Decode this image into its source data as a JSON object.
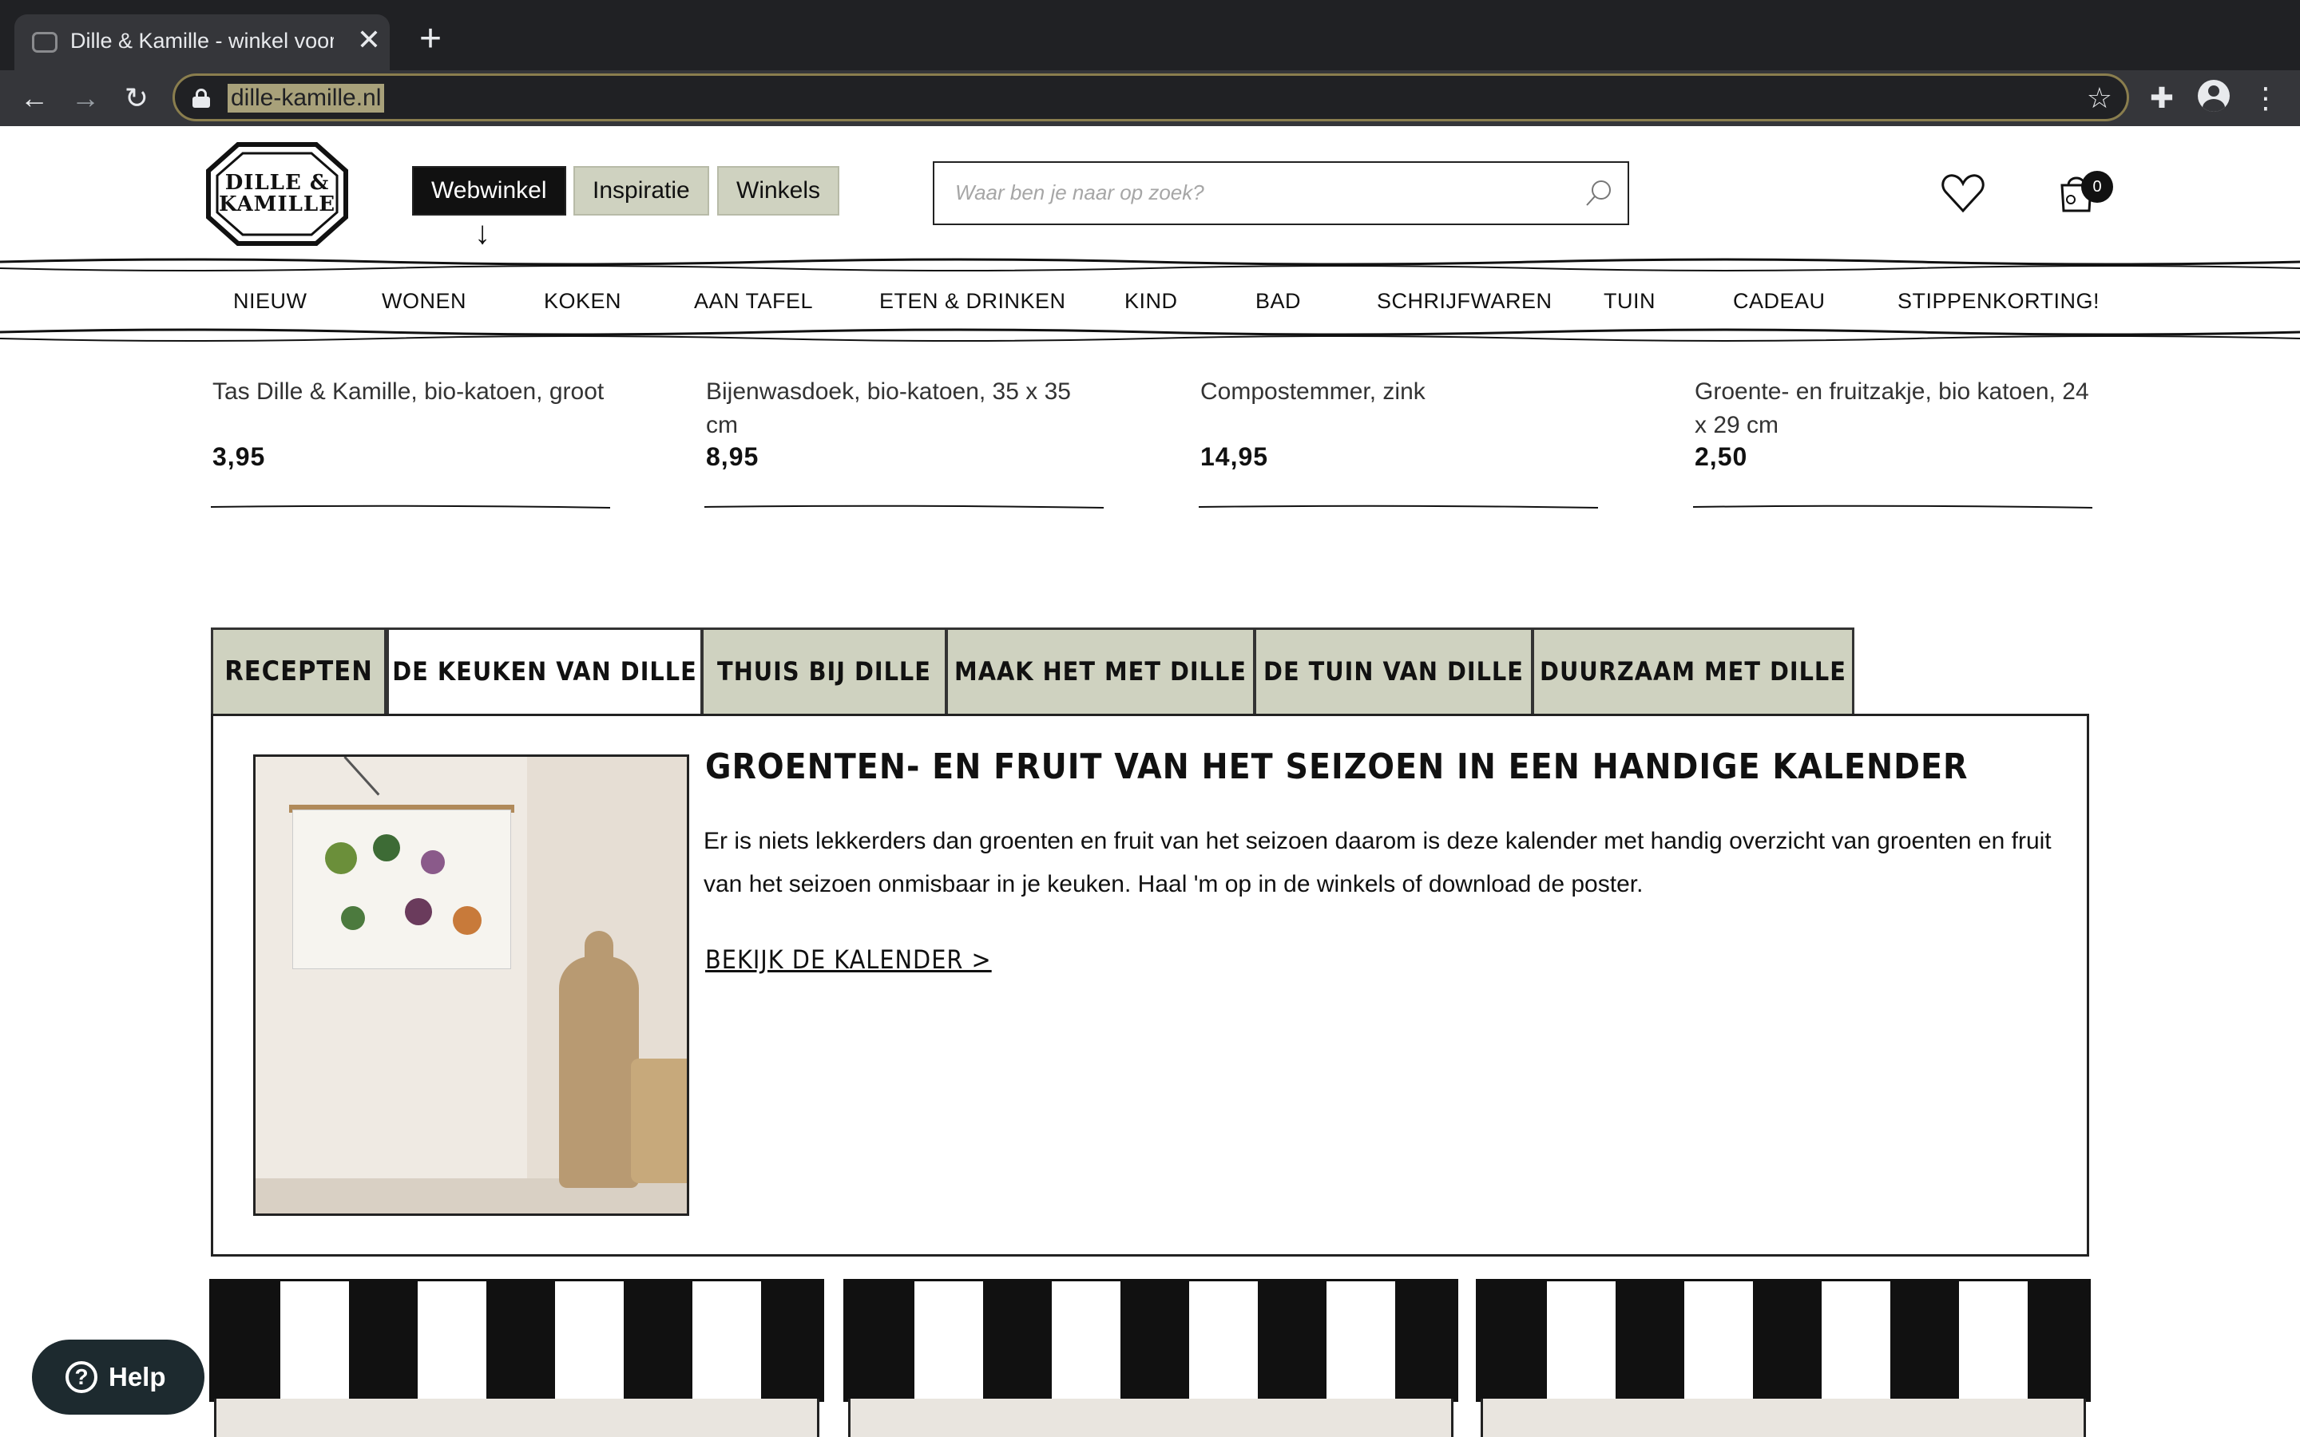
{
  "browser": {
    "tab_title": "Dille & Kamille - winkel voor ca",
    "tab_close": "✕",
    "new_tab": "+",
    "url": "dille-kamille.nl",
    "back": "←",
    "forward": "→",
    "reload": "↻",
    "bookmark": "☆",
    "extensions": "✚",
    "menu": "⋮"
  },
  "header": {
    "logo_line1": "DILLE &",
    "logo_line2": "KAMILLE",
    "nav": [
      "Webwinkel",
      "Inspiratie",
      "Winkels"
    ],
    "arrow": "↓",
    "search_placeholder": "Waar ben je naar op zoek?",
    "cart_count": "0"
  },
  "categories": [
    "NIEUW",
    "WONEN",
    "KOKEN",
    "AAN TAFEL",
    "ETEN & DRINKEN",
    "KIND",
    "BAD",
    "SCHRIJFWAREN",
    "TUIN",
    "CADEAU",
    "STIPPENKORTING!"
  ],
  "products": [
    {
      "name": "Tas Dille & Kamille, bio-katoen, groot",
      "price": "3,95"
    },
    {
      "name": "Bijenwasdoek, bio-katoen, 35 x 35 cm",
      "price": "8,95"
    },
    {
      "name": "Compostemmer, zink",
      "price": "14,95"
    },
    {
      "name": "Groente- en fruitzakje, bio katoen, 24 x 29 cm",
      "price": "2,50"
    }
  ],
  "tabs": [
    "Recepten",
    "De keuken van Dille",
    "Thuis bij Dille",
    "Maak het met Dille",
    "De tuin van Dille",
    "Duurzaam met Dille"
  ],
  "active_tab": 1,
  "feature": {
    "title": "Groenten- en fruit van het seizoen in een handige kalender",
    "body": "Er is niets lekkerders dan groenten en fruit van het seizoen daarom is deze kalender met handig overzicht van groenten en fruit van het seizoen onmisbaar in je keuken. Haal 'm op in de winkels of download de poster.",
    "link": "Bekijk de kalender >"
  },
  "help": {
    "label": "Help",
    "icon": "?"
  },
  "colors": {
    "sage": "#cfd2c0",
    "black": "#111111",
    "chrome_dark": "#202124"
  }
}
